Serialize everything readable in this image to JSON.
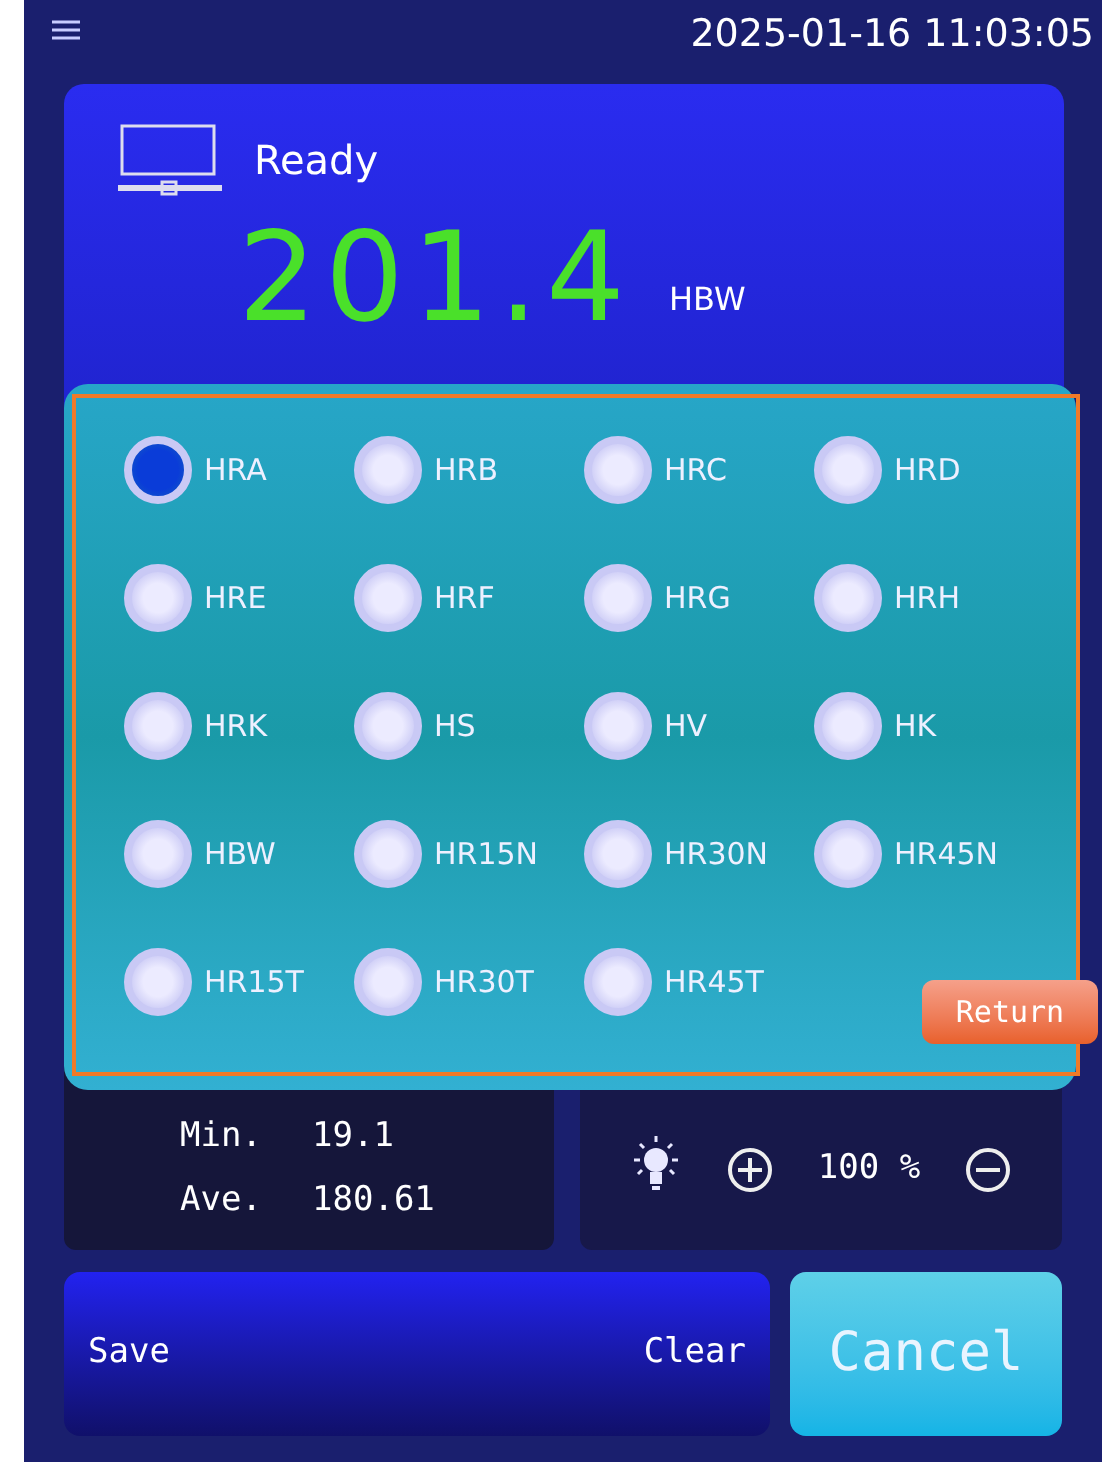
{
  "top_bar": {
    "datetime": "2025-01-16  11:03:05"
  },
  "status": {
    "text": "Ready"
  },
  "reading": {
    "value": "201.4",
    "unit": "HBW"
  },
  "scale_dialog": {
    "options": [
      {
        "label": "HRA",
        "selected": true
      },
      {
        "label": "HRB",
        "selected": false
      },
      {
        "label": "HRC",
        "selected": false
      },
      {
        "label": "HRD",
        "selected": false
      },
      {
        "label": "HRE",
        "selected": false
      },
      {
        "label": "HRF",
        "selected": false
      },
      {
        "label": "HRG",
        "selected": false
      },
      {
        "label": "HRH",
        "selected": false
      },
      {
        "label": "HRK",
        "selected": false
      },
      {
        "label": "HS",
        "selected": false
      },
      {
        "label": "HV",
        "selected": false
      },
      {
        "label": "HK",
        "selected": false
      },
      {
        "label": "HBW",
        "selected": false
      },
      {
        "label": "HR15N",
        "selected": false
      },
      {
        "label": "HR30N",
        "selected": false
      },
      {
        "label": "HR45N",
        "selected": false
      },
      {
        "label": "HR15T",
        "selected": false
      },
      {
        "label": "HR30T",
        "selected": false
      },
      {
        "label": "HR45T",
        "selected": false
      }
    ],
    "return_button": "Return"
  },
  "stats": [
    {
      "label": "Min.",
      "value": "19.1"
    },
    {
      "label": "Ave.",
      "value": "180.61"
    }
  ],
  "brightness": {
    "reading": "100 %"
  },
  "buttons": {
    "save": "Save",
    "clear": "Clear",
    "cancel": "Cancel"
  }
}
